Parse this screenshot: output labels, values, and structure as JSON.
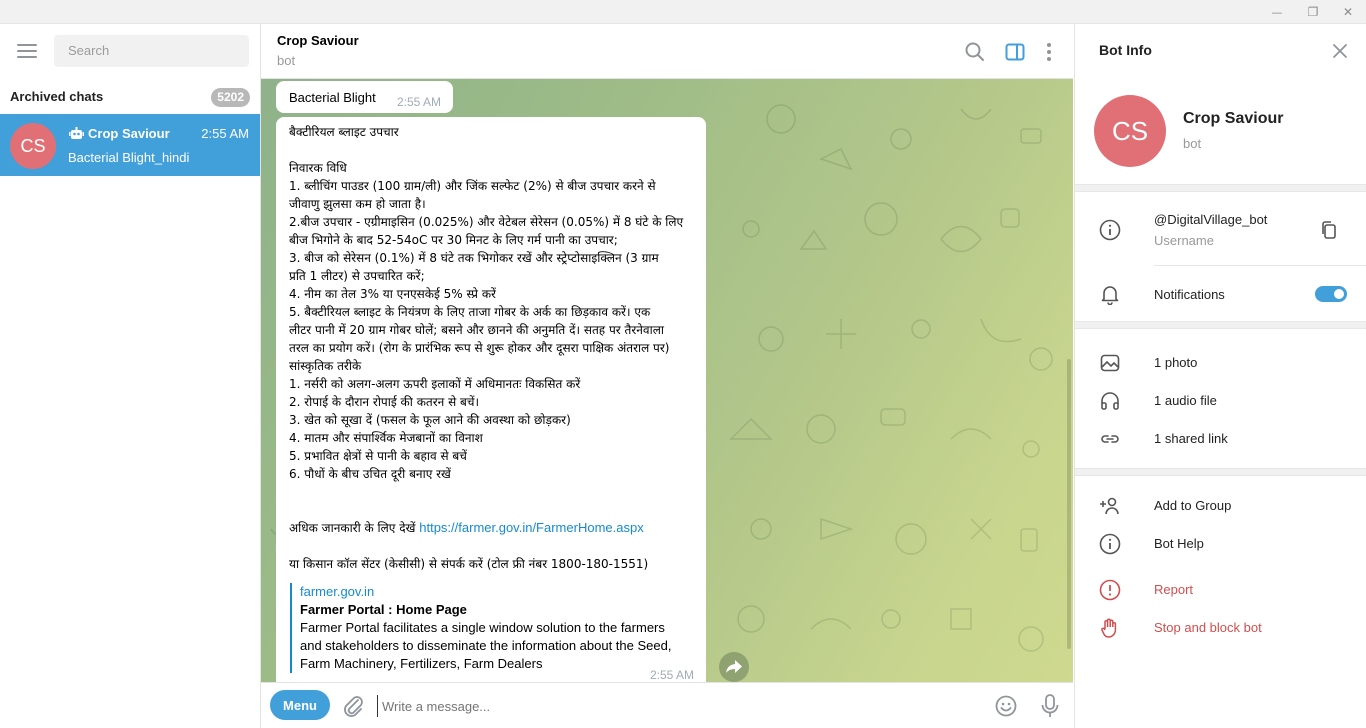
{
  "window": {
    "minimize_glyph": "—",
    "restore_glyph": "❐",
    "close_glyph": "✕"
  },
  "sidebar": {
    "search_placeholder": "Search",
    "archived_label": "Archived chats",
    "archived_count": "5202",
    "chat": {
      "avatar_initials": "CS",
      "name": "Crop Saviour",
      "time": "2:55 AM",
      "preview": "Bacterial Blight_hindi"
    }
  },
  "chat": {
    "title": "Crop Saviour",
    "subtitle": "bot",
    "messages": {
      "first": {
        "text": "Bacterial Blight",
        "time": "2:55 AM"
      },
      "second": {
        "lines": [
          "बैक्टीरियल ब्लाइट उपचार",
          "",
          "निवारक विधि",
          "1. ब्लीचिंग पाउडर (100 ग्राम/ली) और जिंक सल्फेट (2%) से बीज उपचार करने से",
          "जीवाणु झुलसा कम हो जाता है।",
          "2.बीज उपचार - एग्रीमाइसिन (0.025%) और वेटेबल सेरेसन (0.05%) में 8 घंटे के लिए",
          "बीज भिगोने के बाद 52-54oC पर 30 मिनट के लिए गर्म पानी का उपचार;",
          "3. बीज को सेरेसन (0.1%) में 8 घंटे तक भिगोकर रखें और स्ट्रेप्टोसाइक्लिन (3 ग्राम",
          "प्रति 1 लीटर) से उपचारित करें;",
          "4. नीम का तेल 3% या एनएसकेई 5% स्प्रे करें",
          "5. बैक्टीरियल ब्लाइट के नियंत्रण के लिए ताजा गोबर के अर्क का छिड़काव करें। एक",
          "लीटर पानी में 20 ग्राम गोबर घोलें; बसने और छानने की अनुमति दें। सतह पर तैरनेवाला",
          "तरल का प्रयोग करें। (रोग के प्रारंभिक रूप से शुरू होकर और दूसरा पाक्षिक अंतराल पर)",
          "सांस्कृतिक तरीके",
          "1. नर्सरी को अलग-अलग ऊपरी इलाकों में अधिमानतः विकसित करें",
          "2. रोपाई के दौरान रोपाई की कतरन से बचें।",
          "3. खेत को सूखा दें (फसल के फूल आने की अवस्था को छोड़कर)",
          "4. मातम और संपार्श्विक मेजबानों का विनाश",
          "5. प्रभावित क्षेत्रों से पानी के बहाव से बचें",
          "6. पौधों के बीच उचित दूरी बनाए रखें",
          "",
          ""
        ],
        "more_info_prefix": "अधिक जानकारी के लिए देखें ",
        "more_info_link": "https://farmer.gov.in/FarmerHome.aspx",
        "contact_line": "या किसान कॉल सेंटर (केसीसी) से संपर्क करें (टोल फ्री नंबर 1800-180-1551)",
        "link_preview": {
          "site": "farmer.gov.in",
          "title": "Farmer Portal : Home Page",
          "description_lines": [
            "Farmer Portal facilitates a single window solution to the farmers",
            "and stakeholders to disseminate the information about the Seed,",
            "Farm Machinery, Fertilizers, Farm Dealers"
          ]
        },
        "time": "2:55 AM"
      }
    },
    "composer": {
      "menu_label": "Menu",
      "placeholder": "Write a message..."
    }
  },
  "bot_info": {
    "header": "Bot Info",
    "avatar_initials": "CS",
    "name": "Crop Saviour",
    "subtitle": "bot",
    "username": "@DigitalVillage_bot",
    "username_label": "Username",
    "notifications_label": "Notifications",
    "notifications_on": true,
    "media": {
      "photos": "1 photo",
      "audio": "1 audio file",
      "links": "1 shared link"
    },
    "actions": {
      "add_to_group": "Add to Group",
      "bot_help": "Bot Help",
      "report": "Report",
      "stop_block": "Stop and block bot"
    }
  },
  "colors": {
    "accent": "#419fd9",
    "avatar": "#e17076",
    "danger": "#d14e4e",
    "link": "#168acd"
  }
}
